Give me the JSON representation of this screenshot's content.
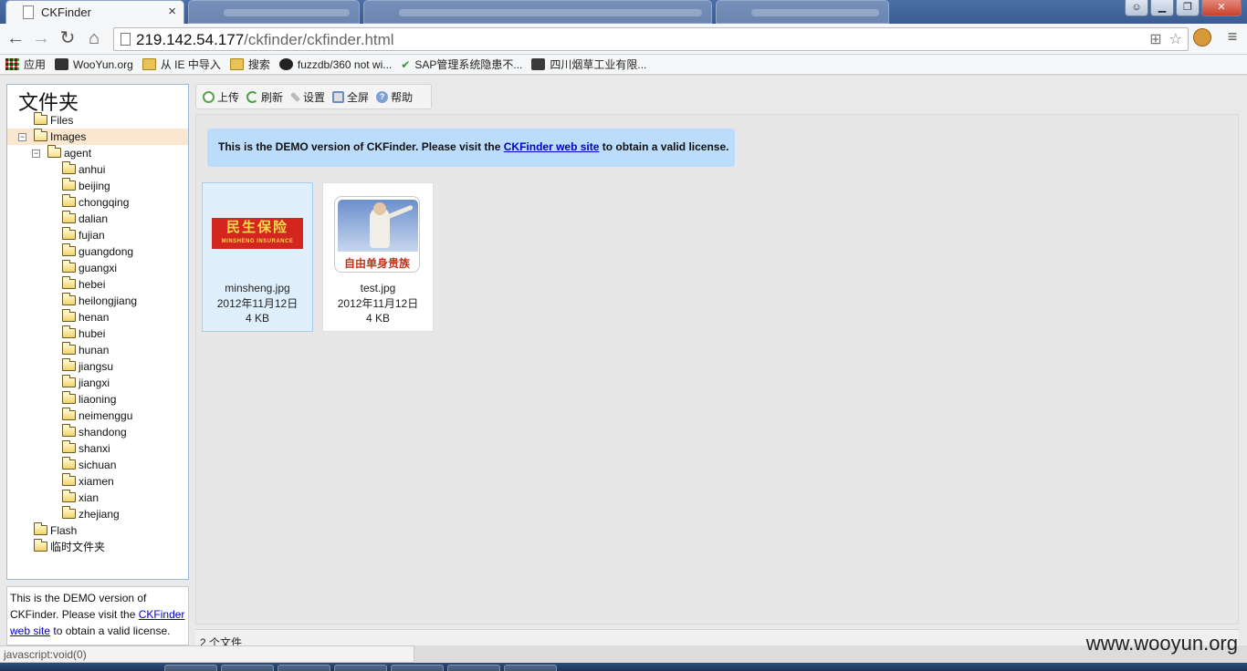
{
  "browser": {
    "active_tab_title": "CKFinder",
    "tab_close": "×",
    "url_host": "219.142.54.177",
    "url_path": "/ckfinder/ckfinder.html",
    "status_text": "javascript:void(0)",
    "win_min": "▁",
    "win_max": "❐",
    "win_close": "✕",
    "back": "←",
    "forward": "→",
    "reload": "↻",
    "home": "⌂",
    "menu": "≡",
    "translate_icon": "⊞",
    "star_icon": "☆"
  },
  "bookmarks": [
    {
      "label": "应用",
      "icon": "apps-icon"
    },
    {
      "label": "WooYun.org",
      "icon": "wooyun-icon"
    },
    {
      "label": "从 IE 中导入",
      "icon": "folder-icon"
    },
    {
      "label": "搜索",
      "icon": "folder-icon"
    },
    {
      "label": "fuzzdb/360 not wi...",
      "icon": "github-icon"
    },
    {
      "label": "SAP管理系统隐患不...",
      "icon": "check-icon"
    },
    {
      "label": "四川烟草工业有限...",
      "icon": "site-icon"
    }
  ],
  "ckfinder": {
    "folders_title": "文件夹",
    "toolbar": {
      "upload": "上传",
      "refresh": "刷新",
      "settings": "设置",
      "fullscreen": "全屏",
      "help": "帮助"
    },
    "tree": [
      {
        "label": "Files",
        "level": 0,
        "expanded": false,
        "selected": false,
        "has_toggle": false
      },
      {
        "label": "Images",
        "level": 0,
        "expanded": true,
        "selected": true,
        "has_toggle": true
      },
      {
        "label": "agent",
        "level": 1,
        "expanded": true,
        "selected": false,
        "has_toggle": true
      },
      {
        "label": "anhui",
        "level": 2
      },
      {
        "label": "beijing",
        "level": 2
      },
      {
        "label": "chongqing",
        "level": 2
      },
      {
        "label": "dalian",
        "level": 2
      },
      {
        "label": "fujian",
        "level": 2
      },
      {
        "label": "guangdong",
        "level": 2
      },
      {
        "label": "guangxi",
        "level": 2
      },
      {
        "label": "hebei",
        "level": 2
      },
      {
        "label": "heilongjiang",
        "level": 2
      },
      {
        "label": "henan",
        "level": 2
      },
      {
        "label": "hubei",
        "level": 2
      },
      {
        "label": "hunan",
        "level": 2
      },
      {
        "label": "jiangsu",
        "level": 2
      },
      {
        "label": "jiangxi",
        "level": 2
      },
      {
        "label": "liaoning",
        "level": 2
      },
      {
        "label": "neimenggu",
        "level": 2
      },
      {
        "label": "shandong",
        "level": 2
      },
      {
        "label": "shanxi",
        "level": 2
      },
      {
        "label": "sichuan",
        "level": 2
      },
      {
        "label": "xiamen",
        "level": 2
      },
      {
        "label": "xian",
        "level": 2
      },
      {
        "label": "zhejiang",
        "level": 2
      },
      {
        "label": "Flash",
        "level": 0
      },
      {
        "label": "临时文件夹",
        "level": 0
      }
    ],
    "notice": {
      "before": "This is the DEMO version of CKFinder. Please visit the ",
      "link": "CKFinder web site",
      "after": " to obtain a valid license."
    },
    "side_notice": {
      "before": "This is the DEMO version of CKFinder. Please visit the ",
      "link": "CKFinder web site",
      "after": " to obtain a valid license."
    },
    "files": [
      {
        "name": "minsheng.jpg",
        "date": "2012年11月12日",
        "size": "4 KB",
        "selected": true,
        "thumb_text": "民生保险",
        "thumb_sub": "MINSHENG INSURANCE"
      },
      {
        "name": "test.jpg",
        "date": "2012年11月12日",
        "size": "4 KB",
        "selected": false,
        "thumb_text": "自由单身贵族"
      }
    ],
    "file_count": "2 个文件"
  },
  "watermark": "www.wooyun.org",
  "colors": {
    "notice_bg": "#bcdcfb",
    "selected_file_bg": "#dfeffc",
    "selected_folder_bg": "#fbe6cf",
    "link": "#0000cc"
  }
}
